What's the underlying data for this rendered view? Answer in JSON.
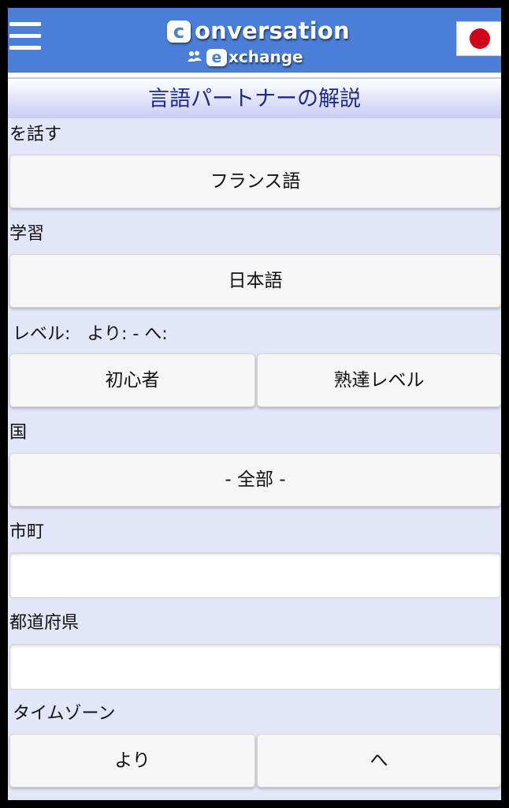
{
  "header": {
    "logo_top_letter": "c",
    "logo_top_text": "onversation",
    "logo_bottom_letter": "e",
    "logo_bottom_text": "xchange",
    "menu_icon": "hamburger-menu-icon",
    "flag_icon": "japan-flag-icon",
    "colors": {
      "header_bg": "#4a7ed7",
      "page_bg": "#e3e5f8",
      "title_color": "#1d2a8a",
      "flag_red": "#d0021b"
    }
  },
  "page_title": "言語パートナーの解説",
  "form": {
    "speaks_label": "を話す",
    "speaks_value": "フランス語",
    "learning_label": "学習",
    "learning_value": "日本語",
    "level_label": "レベル:   より: - へ:",
    "level_from": "初心者",
    "level_to": "熟達レベル",
    "country_label": "国",
    "country_value": "- 全部 -",
    "city_label": "市町",
    "city_value": "",
    "prefecture_label": "都道府県",
    "prefecture_value": "",
    "timezone_label": "タイムゾーン",
    "timezone_from": "より",
    "timezone_to": "へ"
  }
}
